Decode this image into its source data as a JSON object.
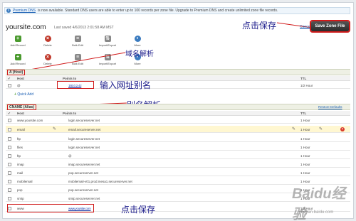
{
  "notice": {
    "link": "Premium DNS",
    "text": "is now available. Standard DNS users are able to enter up to 100 records per zone file. Upgrade to Premium DNS and create unlimited zone file records."
  },
  "header": {
    "domain": "yoursite.com",
    "last_saved": "Last saved 4/6/2013 2:01:58 AM MST",
    "cancel": "Cancel",
    "save": "Save Zone File"
  },
  "annotations": {
    "click_save_top": "点击保存",
    "domain_parse": "域名解析",
    "enter_alias": "输入网址别名",
    "alias_parse": "别名解析",
    "click_save_bottom": "点击保存"
  },
  "toolbar_top": [
    {
      "label": "Add Record",
      "icon": "plus-icon"
    },
    {
      "label": "Delete",
      "icon": "delete-icon"
    },
    {
      "label": "Bulk Edit",
      "icon": "bulk-edit-icon"
    },
    {
      "label": "Import/Export",
      "icon": "import-export-icon"
    },
    {
      "label": "More",
      "icon": "more-icon"
    }
  ],
  "toolbar_bottom": [
    {
      "label": "Add Record",
      "icon": "plus-icon"
    },
    {
      "label": "Delete",
      "icon": "delete-icon"
    },
    {
      "label": "Bulk Edit",
      "icon": "bulk-edit-icon"
    },
    {
      "label": "Import/Export",
      "icon": "import-export-icon"
    },
    {
      "label": "More",
      "icon": "more-icon"
    }
  ],
  "a_section": {
    "title": "A (Host)",
    "columns": {
      "host": "Host",
      "points_to": "Points to",
      "ttl": "TTL"
    },
    "rows": [
      {
        "host": "@",
        "points_to": "192.0.2.42",
        "ttl": "1/2 Hour"
      }
    ],
    "quick_add": "Quick Add"
  },
  "cname_section": {
    "title": "CNAME (Alias)",
    "restore": "Restore Defaults",
    "columns": {
      "host": "Host",
      "points_to": "Points to",
      "ttl": "TTL"
    },
    "rows": [
      {
        "host": "www.yoursite.com",
        "points_to": "login.secureserver.net",
        "ttl": "1 Hour"
      },
      {
        "host": "email",
        "points_to": "email.secureserver.net",
        "ttl": "1 Hour"
      },
      {
        "host": "ftp",
        "points_to": "login.secureserver.net",
        "ttl": "1 Hour"
      },
      {
        "host": "files",
        "points_to": "login.secureserver.net",
        "ttl": "1 Hour"
      },
      {
        "host": "ftp",
        "points_to": "@",
        "ttl": "1 Hour"
      },
      {
        "host": "imap",
        "points_to": "imap.secureserver.net",
        "ttl": "1 Hour"
      },
      {
        "host": "mail",
        "points_to": "pop.secureserver.net",
        "ttl": "1 Hour"
      },
      {
        "host": "mobilemail",
        "points_to": "mobilemail-v01.prod.mesa1.secureserver.net",
        "ttl": "1 Hour"
      },
      {
        "host": "pop",
        "points_to": "pop.secureserver.net",
        "ttl": "1 Hour"
      },
      {
        "host": "smtp",
        "points_to": "smtp.secureserver.net",
        "ttl": "1 Hour"
      },
      {
        "host": "www",
        "points_to": "www.yoursite.com",
        "ttl": "1/2 Hour"
      }
    ]
  },
  "watermark": {
    "brand": "Baidu经验",
    "url": "jingyan.baidu.com"
  },
  "colors": {
    "accent_red": "#d01a1a",
    "annotation": "#1a1a8a",
    "link": "#1a5fb4"
  }
}
